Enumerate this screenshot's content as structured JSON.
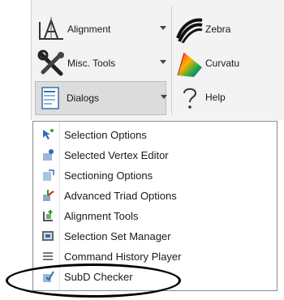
{
  "ribbon": {
    "alignment_label": "Alignment",
    "misc_tools_label": "Misc. Tools",
    "dialogs_label": "Dialogs",
    "zebra_label": "Zebra",
    "curvature_label": "Curvatu",
    "help_label": "Help"
  },
  "menu": {
    "items": [
      {
        "label": "Selection Options",
        "icon": "selection-options-icon"
      },
      {
        "label": "Selected Vertex Editor",
        "icon": "vertex-editor-icon"
      },
      {
        "label": "Sectioning Options",
        "icon": "sectioning-options-icon"
      },
      {
        "label": "Advanced Triad Options",
        "icon": "triad-options-icon"
      },
      {
        "label": "Alignment Tools",
        "icon": "alignment-tools-icon"
      },
      {
        "label": "Selection Set Manager",
        "icon": "selection-set-manager-icon"
      },
      {
        "label": "Command History Player",
        "icon": "command-history-icon"
      },
      {
        "label": "SubD Checker",
        "icon": "subd-checker-icon"
      }
    ]
  }
}
